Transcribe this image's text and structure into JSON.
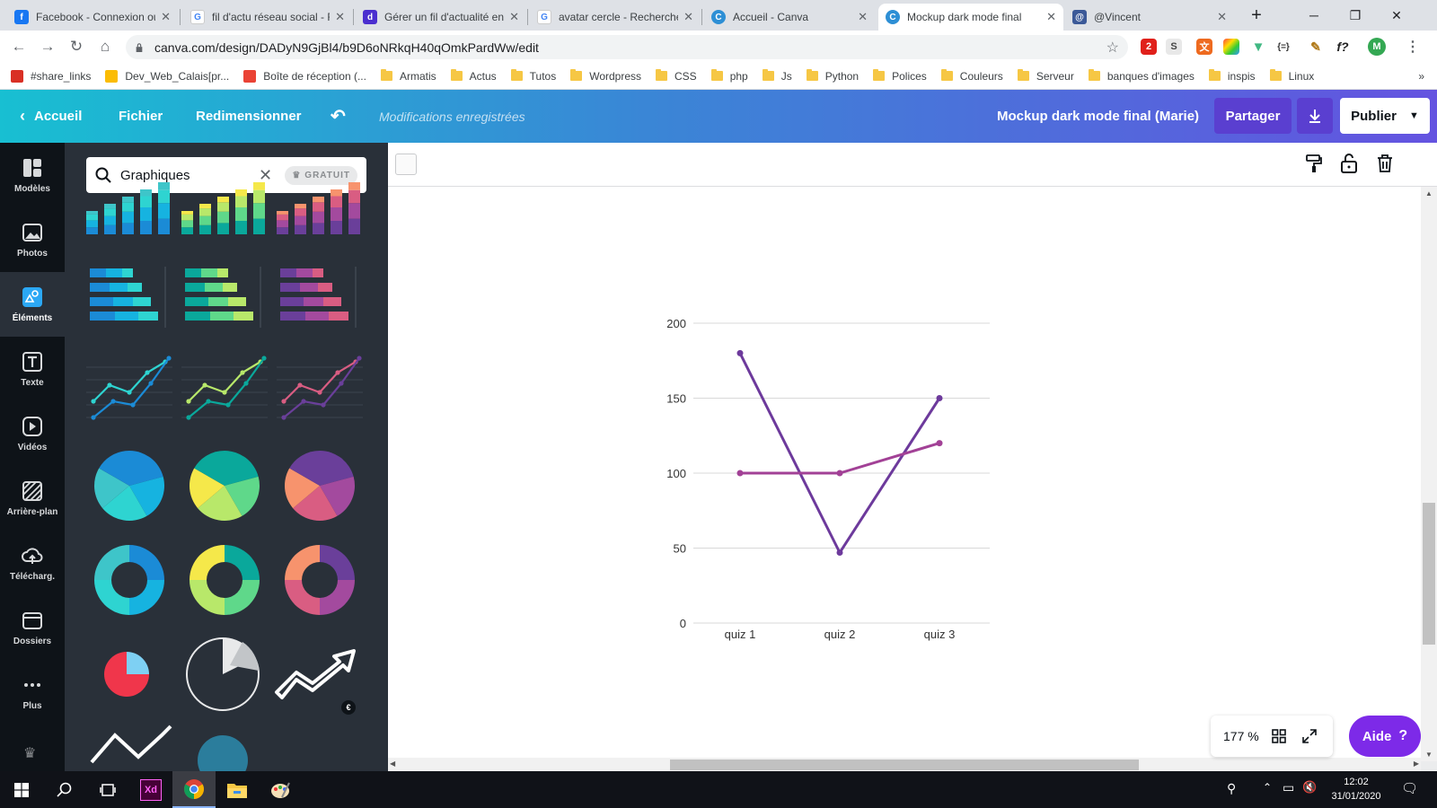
{
  "browser": {
    "tabs": [
      {
        "title": "Facebook - Connexion ou",
        "favicon": "facebook-icon",
        "color": "#1877f2"
      },
      {
        "title": "fil d'actu réseau social - R",
        "favicon": "google-icon",
        "color": "#4285f4"
      },
      {
        "title": "Gérer un fil d'actualité en",
        "favicon": "dailymotion-icon",
        "color": "#4b2fcf"
      },
      {
        "title": "avatar cercle - Recherche",
        "favicon": "google-icon",
        "color": "#4285f4"
      },
      {
        "title": "Accueil - Canva",
        "favicon": "canva-icon",
        "color": "#2d8fd5"
      },
      {
        "title": "Mockup dark mode final",
        "favicon": "canva-icon",
        "color": "#2d8fd5"
      },
      {
        "title": "@Vincent",
        "favicon": "todoist-icon",
        "color": "#3b5998"
      }
    ],
    "active_tab_index": 5,
    "new_tab": "+",
    "url": "canva.com/design/DADyN9GjBl4/b9D6oNRkqH40qOmkPardWw/edit",
    "profile_initial": "M",
    "extensions": [
      "adblock-icon",
      "s-icon",
      "translate-icon",
      "color-icon",
      "vue-icon",
      "json-icon",
      "pencil-icon",
      "formula-icon"
    ],
    "ext_badges": {
      "adblock": "2",
      "formula": "f?",
      "json": "{=}",
      "s": "S"
    },
    "bookmarks": [
      {
        "label": "#share_links",
        "icon": "share-icon"
      },
      {
        "label": "Dev_Web_Calais[pr...",
        "icon": "drive-icon"
      },
      {
        "label": "Boîte de réception (...",
        "icon": "gmail-icon"
      },
      {
        "label": "Armatis",
        "icon": "folder-icon"
      },
      {
        "label": "Actus",
        "icon": "folder-icon"
      },
      {
        "label": "Tutos",
        "icon": "folder-icon"
      },
      {
        "label": "Wordpress",
        "icon": "folder-icon"
      },
      {
        "label": "CSS",
        "icon": "folder-icon"
      },
      {
        "label": "php",
        "icon": "folder-icon"
      },
      {
        "label": "Js",
        "icon": "folder-icon"
      },
      {
        "label": "Python",
        "icon": "folder-icon"
      },
      {
        "label": "Polices",
        "icon": "folder-icon"
      },
      {
        "label": "Couleurs",
        "icon": "folder-icon"
      },
      {
        "label": "Serveur",
        "icon": "folder-icon"
      },
      {
        "label": "banques d'images",
        "icon": "folder-icon"
      },
      {
        "label": "inspis",
        "icon": "folder-icon"
      },
      {
        "label": "Linux",
        "icon": "folder-icon"
      }
    ],
    "more_bookmarks": "»"
  },
  "header": {
    "home": "Accueil",
    "file": "Fichier",
    "resize": "Redimensionner",
    "status": "Modifications enregistrées",
    "doc_title": "Mockup dark mode final (Marie)",
    "share": "Partager",
    "publish": "Publier"
  },
  "rail": [
    {
      "label": "Modèles",
      "icon": "templates-icon"
    },
    {
      "label": "Photos",
      "icon": "photos-icon"
    },
    {
      "label": "Éléments",
      "icon": "elements-icon",
      "active": true
    },
    {
      "label": "Texte",
      "icon": "text-icon"
    },
    {
      "label": "Vidéos",
      "icon": "video-icon"
    },
    {
      "label": "Arrière-plan",
      "icon": "background-icon"
    },
    {
      "label": "Télécharg.",
      "icon": "upload-icon"
    },
    {
      "label": "Dossiers",
      "icon": "folder-icon"
    },
    {
      "label": "Plus",
      "icon": "more-icon"
    }
  ],
  "panel": {
    "search_value": "Graphiques",
    "badge": "GRATUIT",
    "pro_badge": "€",
    "palettes": {
      "blue": [
        "#1b8bd6",
        "#16b3e0",
        "#2ed4d1",
        "#3ec5c9"
      ],
      "green": [
        "#0aa89b",
        "#5fd88a",
        "#b8e86a",
        "#f5e84a"
      ],
      "purple": [
        "#6a3f9a",
        "#a34a9e",
        "#d95d82",
        "#f7936d"
      ]
    }
  },
  "canvas": {
    "zoom": "177 %",
    "help": "Aide",
    "help_icon": "?",
    "page_color": "#ffffff"
  },
  "chart_data": {
    "type": "line",
    "categories": [
      "quiz 1",
      "quiz 2",
      "quiz 3"
    ],
    "series": [
      {
        "values": [
          180,
          47,
          150
        ],
        "color": "#6d3a9c"
      },
      {
        "values": [
          100,
          100,
          120
        ],
        "color": "#a24196"
      }
    ],
    "ylim": [
      0,
      200
    ],
    "yticks": [
      0,
      50,
      100,
      150,
      200
    ],
    "grid": true
  },
  "taskbar": {
    "time": "12:02",
    "date": "31/01/2020",
    "apps": [
      "windows-start-icon",
      "search-icon",
      "task-view-icon",
      "xd-icon",
      "chrome-icon",
      "file-explorer-icon",
      "paint-icon"
    ]
  }
}
